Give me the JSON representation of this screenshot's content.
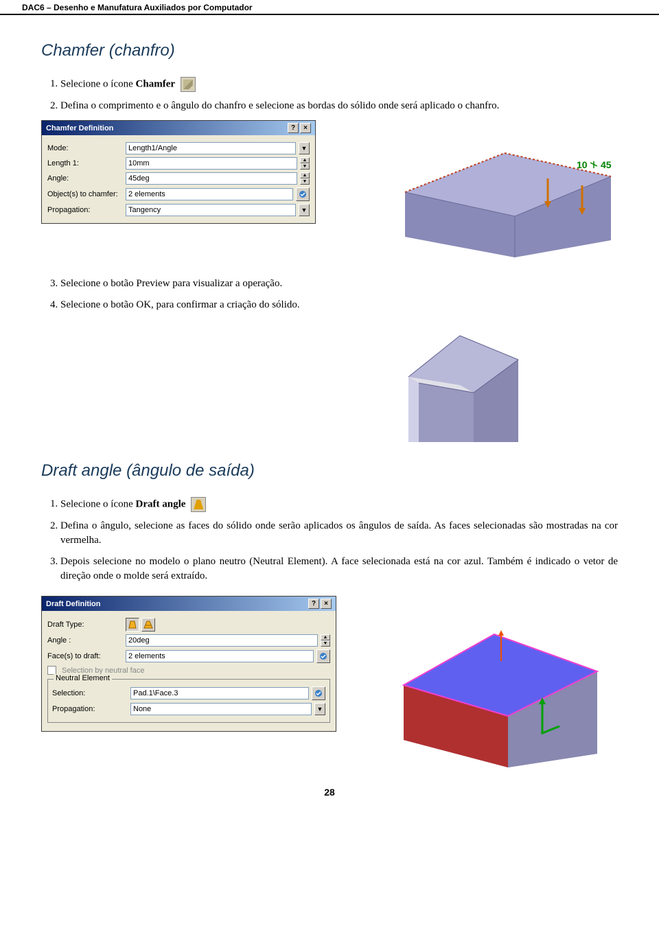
{
  "header": "DAC6 – Desenho e Manufatura Auxiliados por Computador",
  "section1": {
    "title": "Chamfer (chanfro)",
    "step1_pre": "Selecione o ícone ",
    "step1_b": "Chamfer",
    "step2": "Defina o comprimento e o ângulo do chanfro e selecione as bordas do sólido onde será aplicado o chanfro.",
    "step3": "Selecione o botão Preview para visualizar a operação.",
    "step4": "Selecione o botão OK, para confirmar a criação do sólido."
  },
  "chamfer_dlg": {
    "title": "Chamfer Definition",
    "l_mode": "Mode:",
    "v_mode": "Length1/Angle",
    "l_len": "Length 1:",
    "v_len": "10mm",
    "l_ang": "Angle:",
    "v_ang": "45deg",
    "l_obj": "Object(s) to chamfer:",
    "v_obj": "2 elements",
    "l_prop": "Propagation:",
    "v_prop": "Tangency"
  },
  "chamfer_preview": {
    "label1": "10",
    "label2": "45"
  },
  "section2": {
    "title": "Draft angle (ângulo de saída)",
    "step1_pre": "Selecione o ícone ",
    "step1_b": "Draft angle",
    "step2": "Defina o ângulo,  selecione as faces do sólido onde serão aplicados os ângulos de saída. As faces selecionadas são mostradas na cor vermelha.",
    "step3": "Depois selecione no modelo o plano neutro (Neutral Element). A face selecionada está na  cor azul. Também é indicado o vetor de direção onde o molde será extraído."
  },
  "draft_dlg": {
    "title": "Draft Definition",
    "l_type": "Draft Type:",
    "l_ang": "Angle :",
    "v_ang": "20deg",
    "l_faces": "Face(s) to draft:",
    "v_faces": "2 elements",
    "l_selneut": "Selection by neutral face",
    "g_neut": "Neutral Element",
    "l_sel": "Selection:",
    "v_sel": "Pad.1\\Face.3",
    "l_prop": "Propagation:",
    "v_prop": "None"
  },
  "page_number": "28"
}
